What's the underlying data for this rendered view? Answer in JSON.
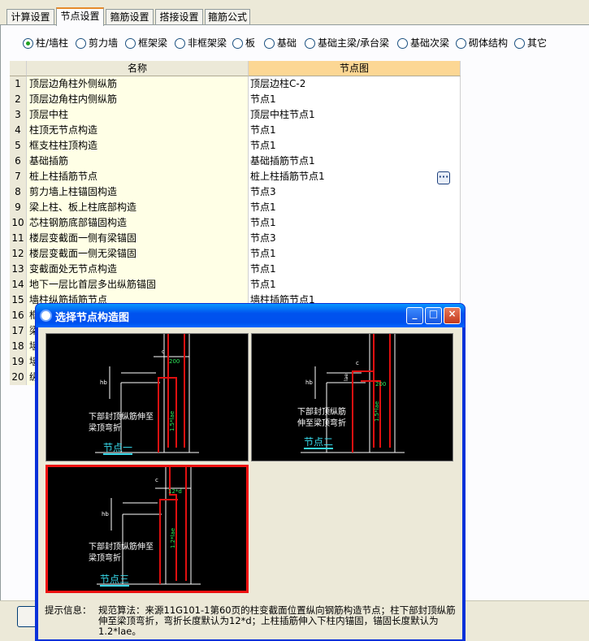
{
  "tabs": [
    "计算设置",
    "节点设置",
    "箍筋设置",
    "搭接设置",
    "箍筋公式"
  ],
  "active_tab": "节点设置",
  "radios": [
    {
      "label": "柱/墙柱",
      "checked": true
    },
    {
      "label": "剪力墙",
      "checked": false
    },
    {
      "label": "框架梁",
      "checked": false
    },
    {
      "label": "非框架梁",
      "checked": false
    },
    {
      "label": "板",
      "checked": false
    },
    {
      "label": "基础",
      "checked": false
    },
    {
      "label": "基础主梁/承台梁",
      "checked": false
    },
    {
      "label": "基础次梁",
      "checked": false
    },
    {
      "label": "砌体结构",
      "checked": false
    },
    {
      "label": "其它",
      "checked": false
    }
  ],
  "grid": {
    "headers": {
      "name": "名称",
      "node": "节点图"
    },
    "rows": [
      {
        "num": "1",
        "name": "顶层边角柱外侧纵筋",
        "node": "顶层边柱C-2"
      },
      {
        "num": "2",
        "name": "顶层边角柱内侧纵筋",
        "node": "节点1"
      },
      {
        "num": "3",
        "name": "顶层中柱",
        "node": "顶层中柱节点1"
      },
      {
        "num": "4",
        "name": "柱顶无节点构造",
        "node": "节点1"
      },
      {
        "num": "5",
        "name": "框支柱柱顶构造",
        "node": "节点1"
      },
      {
        "num": "6",
        "name": "基础插筋",
        "node": "基础插筋节点1"
      },
      {
        "num": "7",
        "name": "桩上柱插筋节点",
        "node": "桩上柱插筋节点1"
      },
      {
        "num": "8",
        "name": "剪力墙上柱锚固构造",
        "node": "节点3"
      },
      {
        "num": "9",
        "name": "梁上柱、板上柱底部构造",
        "node": "节点1"
      },
      {
        "num": "10",
        "name": "芯柱钢筋底部锚固构造",
        "node": "节点1"
      },
      {
        "num": "11",
        "name": "楼层变截面一侧有梁锚固",
        "node": "节点3"
      },
      {
        "num": "12",
        "name": "楼层变截面一侧无梁锚固",
        "node": "节点1"
      },
      {
        "num": "13",
        "name": "变截面处无节点构造",
        "node": "节点1"
      },
      {
        "num": "14",
        "name": "地下一层比首层多出纵筋锚固",
        "node": "节点1"
      },
      {
        "num": "15",
        "name": "墙柱纵筋插筋节点",
        "node": "墙柱插筋节点1"
      },
      {
        "num": "16",
        "name": "框",
        "node": ""
      },
      {
        "num": "17",
        "name": "梁",
        "node": ""
      },
      {
        "num": "18",
        "name": "墙",
        "node": ""
      },
      {
        "num": "19",
        "name": "墙",
        "node": ""
      },
      {
        "num": "20",
        "name": "纵",
        "node": ""
      }
    ],
    "ellipsis": "···"
  },
  "dialog": {
    "title": "选择节点构造图",
    "min": "_",
    "max": "□",
    "close": "×",
    "nodes": [
      {
        "caption": "节点一",
        "note1": "下部封顶纵筋伸至",
        "note2": "梁顶弯折",
        "dim1": "200",
        "dim2": "1.5*lae",
        "lbl_c": "c",
        "lbl_hb": "hb"
      },
      {
        "caption": "节点二",
        "note1": "下部封顶纵筋",
        "note2": "伸至梁顶弯折",
        "dim1": "200",
        "dim2": "1.5*lae",
        "lbl_c": "c",
        "lbl_hb": "hb",
        "lbl_lae": "lae"
      },
      {
        "caption": "节点三",
        "note1": "下部封顶纵筋伸至",
        "note2": "梁顶弯折",
        "dim1": "12*d",
        "dim2": "1.2*lae",
        "lbl_c": "c",
        "lbl_hb": "hb"
      }
    ],
    "selected": "节点三",
    "info_label": "提示信息：",
    "info_text": "规范算法：来源11G101-1第60页的柱变截面位置纵向钢筋构造节点；柱下部封顶纵筋伸至梁顶弯折，弯折长度默认为12*d；上柱插筋伸入下柱内锚固，锚固长度默认为1.2*lae。"
  },
  "colors": {
    "tab_accent": "#e68b2c",
    "header_node": "#fcd794",
    "name_col": "#ffffe6",
    "selected_border": "#ee1111",
    "caption": "#36d6e7"
  }
}
